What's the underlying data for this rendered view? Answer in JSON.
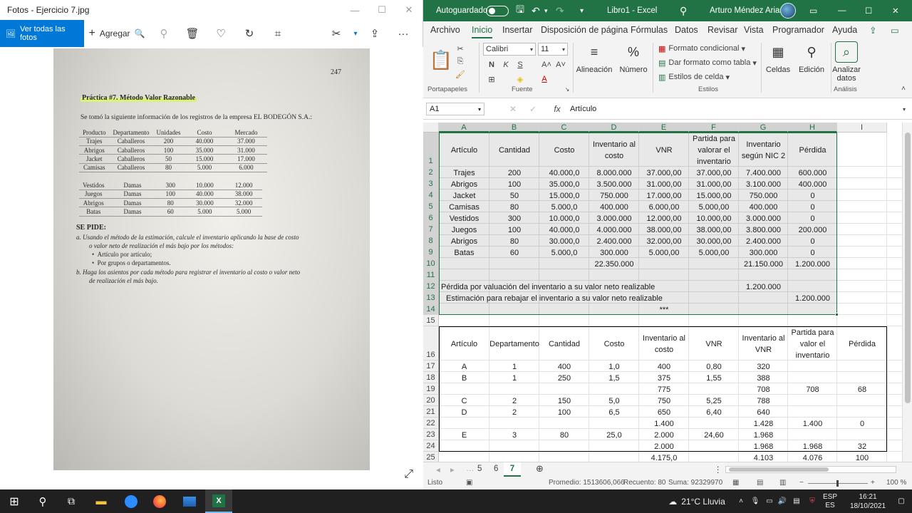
{
  "photos": {
    "title": "Fotos - Ejercicio 7.jpg",
    "see_all": "Ver todas las fotos",
    "add": "Agregar",
    "image": {
      "page_number": "247",
      "title": "Práctica #7. Método Valor Razonable",
      "intro": "Se tomó la siguiente información de los registros de la empresa EL BODEGÓN S.A.:",
      "headers": [
        "Producto",
        "Departamento",
        "Unidades",
        "Costo",
        "Mercado"
      ],
      "group1": [
        [
          "Trajes",
          "Caballeros",
          "200",
          "40.000",
          "37.000"
        ],
        [
          "Abrigos",
          "Caballeros",
          "100",
          "35.000",
          "31.000"
        ],
        [
          "Jacket",
          "Caballeros",
          "50",
          "15.000",
          "17.000"
        ],
        [
          "Camisas",
          "Caballeros",
          "80",
          "5.000",
          "6.000"
        ]
      ],
      "group2": [
        [
          "Vestidos",
          "Damas",
          "300",
          "10.000",
          "12.000"
        ],
        [
          "Juegos",
          "Damas",
          "100",
          "40.000",
          "38.000"
        ],
        [
          "Abrigos",
          "Damas",
          "80",
          "30.000",
          "32.000"
        ],
        [
          "Batas",
          "Damas",
          "60",
          "5.000",
          "5.000"
        ]
      ],
      "se_pide": "SE PIDE:",
      "req_a": "a.   Usando el método de la estimación, calcule el inventario aplicando la base de costo",
      "req_a2": "o valor neto de realización el más bajo por los métodos:",
      "bullet1": "Artículo por artículo;",
      "bullet2": "Por grupos o departamentos.",
      "req_b": "b.   Haga los asientos por cada método para registrar el inventario al costo o valor neto",
      "req_b2": "de realización el más bajo."
    }
  },
  "excel": {
    "autosave": "Autoguardado",
    "filename": "Libro1 - Excel",
    "user": "Arturo Méndez Arias",
    "tabs": [
      "Archivo",
      "Inicio",
      "Insertar",
      "Disposición de página",
      "Fórmulas",
      "Datos",
      "Revisar",
      "Vista",
      "Programador",
      "Ayuda"
    ],
    "active_tab": "Inicio",
    "ribbon": {
      "font_name": "Calibri",
      "font_size": "11",
      "portapapeles": "Portapapeles",
      "fuente": "Fuente",
      "alineacion": "Alineación",
      "numero": "Número",
      "formato_condicional": "Formato condicional",
      "dar_formato": "Dar formato como tabla",
      "estilos_celda": "Estilos de celda",
      "estilos": "Estilos",
      "celdas": "Celdas",
      "edicion": "Edición",
      "analizar": "Analizar",
      "datos": "datos",
      "analisis": "Análisis"
    },
    "name_box": "A1",
    "formula": "Artículo",
    "columns": [
      "A",
      "B",
      "C",
      "D",
      "E",
      "F",
      "G",
      "H",
      "I"
    ],
    "rows": [
      {
        "n": "1",
        "cells": [
          "Artículo",
          "Cantidad",
          "Costo",
          "Inventario al costo",
          "VNR",
          "Partida para valorar el inventario",
          "Inventario según NIC 2",
          "Pérdida",
          ""
        ]
      },
      {
        "n": "2",
        "cells": [
          "Trajes",
          "200",
          "40.000,0",
          "8.000.000",
          "37.000,00",
          "37.000,00",
          "7.400.000",
          "600.000",
          ""
        ]
      },
      {
        "n": "3",
        "cells": [
          "Abrigos",
          "100",
          "35.000,0",
          "3.500.000",
          "31.000,00",
          "31.000,00",
          "3.100.000",
          "400.000",
          ""
        ]
      },
      {
        "n": "4",
        "cells": [
          "Jacket",
          "50",
          "15.000,0",
          "750.000",
          "17.000,00",
          "15.000,00",
          "750.000",
          "0",
          ""
        ]
      },
      {
        "n": "5",
        "cells": [
          "Camisas",
          "80",
          "5.000,0",
          "400.000",
          "6.000,00",
          "5.000,00",
          "400.000",
          "0",
          ""
        ]
      },
      {
        "n": "6",
        "cells": [
          "Vestidos",
          "300",
          "10.000,0",
          "3.000.000",
          "12.000,00",
          "10.000,00",
          "3.000.000",
          "0",
          ""
        ]
      },
      {
        "n": "7",
        "cells": [
          "Juegos",
          "100",
          "40.000,0",
          "4.000.000",
          "38.000,00",
          "38.000,00",
          "3.800.000",
          "200.000",
          ""
        ]
      },
      {
        "n": "8",
        "cells": [
          "Abrigos",
          "80",
          "30.000,0",
          "2.400.000",
          "32.000,00",
          "30.000,00",
          "2.400.000",
          "0",
          ""
        ]
      },
      {
        "n": "9",
        "cells": [
          "Batas",
          "60",
          "5.000,0",
          "300.000",
          "5.000,00",
          "5.000,00",
          "300.000",
          "0",
          ""
        ]
      },
      {
        "n": "10",
        "cells": [
          "",
          "",
          "",
          "22.350.000",
          "",
          "",
          "21.150.000",
          "1.200.000",
          ""
        ]
      },
      {
        "n": "11",
        "cells": [
          "",
          "",
          "",
          "",
          "",
          "",
          "",
          "",
          ""
        ]
      },
      {
        "n": "12",
        "cells": [
          "Pérdida por valuación del inventario a su valor neto realizable",
          "",
          "",
          "",
          "",
          "",
          "1.200.000",
          "",
          ""
        ]
      },
      {
        "n": "13",
        "cells": [
          "Estimación para rebajar el inventario a su valor neto realizable",
          "",
          "",
          "",
          "",
          "",
          "",
          "1.200.000",
          ""
        ]
      },
      {
        "n": "14",
        "cells": [
          "",
          "",
          "",
          "",
          "***",
          "",
          "",
          "",
          ""
        ]
      },
      {
        "n": "15",
        "cells": [
          "",
          "",
          "",
          "",
          "",
          "",
          "",
          "",
          ""
        ]
      },
      {
        "n": "16",
        "cells": [
          "Artículo",
          "Departamento",
          "Cantidad",
          "Costo",
          "Inventario al costo",
          "VNR",
          "Inventario al VNR",
          "Partida para valor el inventario",
          "Pérdida"
        ]
      },
      {
        "n": "17",
        "cells": [
          "A",
          "1",
          "400",
          "1,0",
          "400",
          "0,80",
          "320",
          "",
          ""
        ]
      },
      {
        "n": "18",
        "cells": [
          "B",
          "1",
          "250",
          "1,5",
          "375",
          "1,55",
          "388",
          "",
          ""
        ]
      },
      {
        "n": "19",
        "cells": [
          "",
          "",
          "",
          "",
          "775",
          "",
          "708",
          "708",
          "68"
        ]
      },
      {
        "n": "20",
        "cells": [
          "C",
          "2",
          "150",
          "5,0",
          "750",
          "5,25",
          "788",
          "",
          ""
        ]
      },
      {
        "n": "21",
        "cells": [
          "D",
          "2",
          "100",
          "6,5",
          "650",
          "6,40",
          "640",
          "",
          ""
        ]
      },
      {
        "n": "22",
        "cells": [
          "",
          "",
          "",
          "",
          "1.400",
          "",
          "1.428",
          "1.400",
          "0"
        ]
      },
      {
        "n": "23",
        "cells": [
          "E",
          "3",
          "80",
          "25,0",
          "2.000",
          "24,60",
          "1.968",
          "",
          ""
        ]
      },
      {
        "n": "24",
        "cells": [
          "",
          "",
          "",
          "",
          "2.000",
          "",
          "1.968",
          "1.968",
          "32"
        ]
      },
      {
        "n": "25",
        "cells": [
          "",
          "",
          "",
          "",
          "4.175,0",
          "",
          "4.103",
          "4.076",
          "100"
        ]
      }
    ],
    "sheets": [
      "5",
      "6",
      "7"
    ],
    "active_sheet": "7",
    "status": {
      "ready": "Listo",
      "average": "Promedio: 1513606,066",
      "count": "Recuento: 80",
      "sum": "Suma: 92329970",
      "zoom": "100 %"
    }
  },
  "taskbar": {
    "weather": "21°C  Lluvia",
    "lang": "ESP",
    "lang2": "ES",
    "time": "16:21",
    "date": "18/10/2021"
  }
}
